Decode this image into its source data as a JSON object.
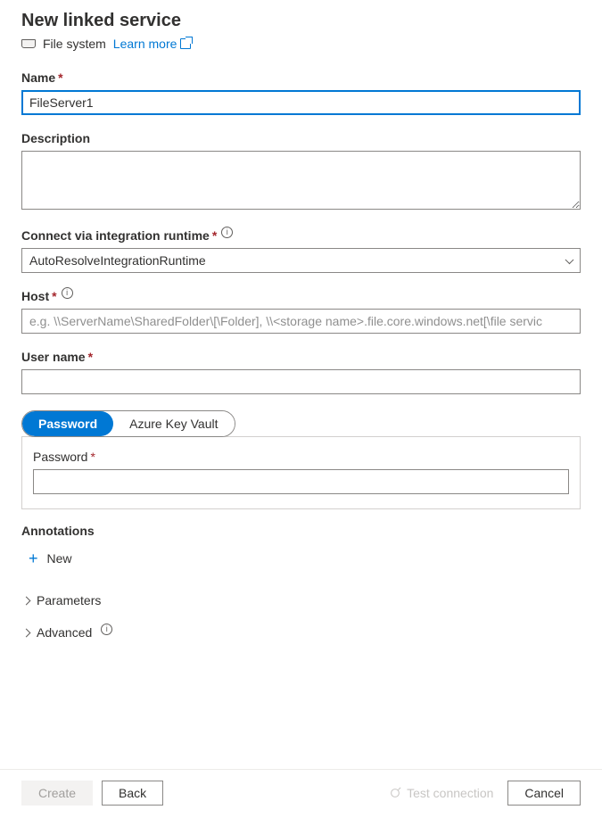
{
  "header": {
    "title": "New linked service",
    "subtitle": "File system",
    "learn_more": "Learn more"
  },
  "form": {
    "name": {
      "label": "Name",
      "value": "FileServer1"
    },
    "description": {
      "label": "Description",
      "value": ""
    },
    "runtime": {
      "label": "Connect via integration runtime",
      "value": "AutoResolveIntegrationRuntime"
    },
    "host": {
      "label": "Host",
      "placeholder": "e.g. \\\\ServerName\\SharedFolder\\[\\Folder], \\\\<storage name>.file.core.windows.net[\\file servic",
      "value": ""
    },
    "username": {
      "label": "User name",
      "value": ""
    },
    "auth_tabs": {
      "password": "Password",
      "keyvault": "Azure Key Vault",
      "pw_field_label": "Password",
      "pw_value": ""
    },
    "annotations": {
      "label": "Annotations",
      "new_btn": "New"
    },
    "parameters": {
      "label": "Parameters"
    },
    "advanced": {
      "label": "Advanced"
    }
  },
  "footer": {
    "create": "Create",
    "back": "Back",
    "test_connection": "Test connection",
    "cancel": "Cancel"
  }
}
